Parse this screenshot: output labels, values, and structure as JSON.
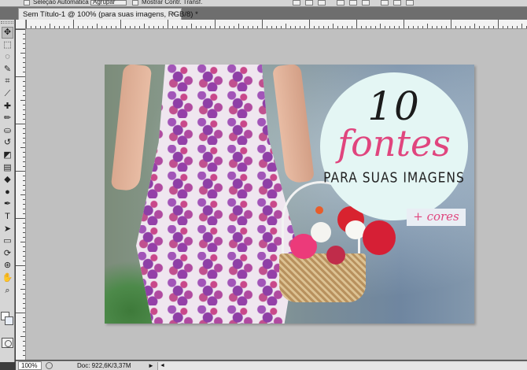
{
  "options_bar": {
    "item1": "Seleção Automática",
    "item2": "Agrupar",
    "item3": "Mostrar Contr. Transf."
  },
  "document_tab": {
    "title": "Sem Título-1 @ 100% (para suas imagens, RGB/8) *",
    "close_glyph": "×"
  },
  "tools": [
    {
      "name": "move-tool-icon",
      "glyph": "✥"
    },
    {
      "name": "marquee-tool-icon",
      "glyph": "⬚"
    },
    {
      "name": "lasso-tool-icon",
      "glyph": "◌"
    },
    {
      "name": "quick-selection-tool-icon",
      "glyph": "✎"
    },
    {
      "name": "crop-tool-icon",
      "glyph": "⌗"
    },
    {
      "name": "eyedropper-tool-icon",
      "glyph": "⟋"
    },
    {
      "name": "healing-brush-tool-icon",
      "glyph": "✚"
    },
    {
      "name": "brush-tool-icon",
      "glyph": "✏"
    },
    {
      "name": "clone-stamp-tool-icon",
      "glyph": "⛀"
    },
    {
      "name": "history-brush-tool-icon",
      "glyph": "↺"
    },
    {
      "name": "eraser-tool-icon",
      "glyph": "◩"
    },
    {
      "name": "gradient-tool-icon",
      "glyph": "▤"
    },
    {
      "name": "blur-tool-icon",
      "glyph": "◆"
    },
    {
      "name": "dodge-tool-icon",
      "glyph": "●"
    },
    {
      "name": "pen-tool-icon",
      "glyph": "✒"
    },
    {
      "name": "type-tool-icon",
      "glyph": "T"
    },
    {
      "name": "path-selection-tool-icon",
      "glyph": "➤"
    },
    {
      "name": "shape-tool-icon",
      "glyph": "▭"
    },
    {
      "name": "3d-rotate-tool-icon",
      "glyph": "⟳"
    },
    {
      "name": "3d-orbit-tool-icon",
      "glyph": "⊛"
    },
    {
      "name": "hand-tool-icon",
      "glyph": "✋"
    },
    {
      "name": "zoom-tool-icon",
      "glyph": "⌕"
    }
  ],
  "artwork": {
    "number": "10",
    "headline": "fontes",
    "subline": "PARA SUAS IMAGENS",
    "tag": "+ cores"
  },
  "status_bar": {
    "zoom": "100%",
    "doc_info": "Doc: 922,6K/3,37M",
    "arrow": "►",
    "scroll_left": "◄"
  },
  "colors": {
    "accent_pink": "#e0457e",
    "circle_fill": "#e4f6f4",
    "workspace": "#c0c0c0"
  }
}
